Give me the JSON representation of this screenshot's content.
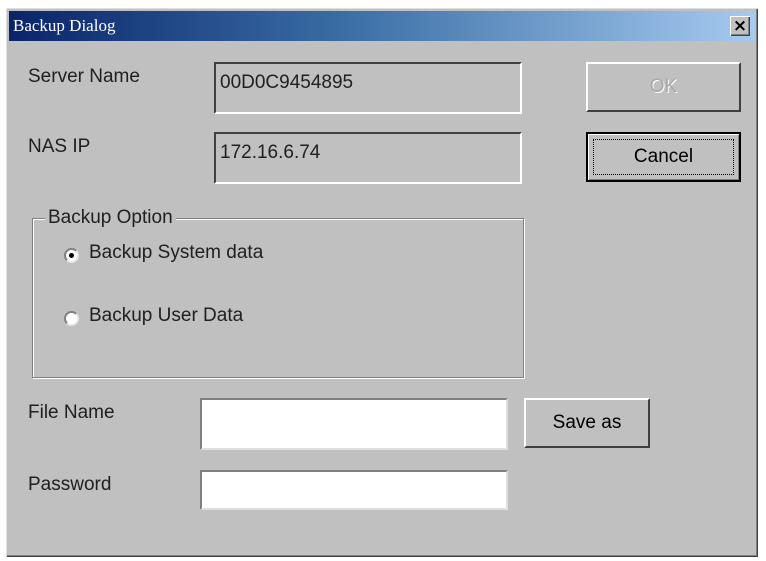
{
  "window": {
    "title": "Backup Dialog",
    "close_glyph": "×"
  },
  "fields": {
    "server_name_label": "Server Name",
    "server_name_value": "00D0C9454895",
    "nas_ip_label": "NAS IP",
    "nas_ip_value": "172.16.6.74",
    "file_name_label": "File Name",
    "file_name_value": "",
    "password_label": "Password",
    "password_value": ""
  },
  "buttons": {
    "ok": "OK",
    "ok_enabled": false,
    "cancel": "Cancel",
    "save_as": "Save as"
  },
  "backup_option": {
    "legend": "Backup Option",
    "options": [
      {
        "label": "Backup System data",
        "selected": true
      },
      {
        "label": "Backup User Data",
        "selected": false
      }
    ]
  },
  "icons": {
    "close": "close-icon",
    "radio_selected": "radio-selected-icon",
    "radio_unselected": "radio-unselected-icon"
  },
  "colors": {
    "dialog_bg": "#c0c0c0",
    "titlebar_start": "#0a246a",
    "titlebar_end": "#a6caf0",
    "disabled_text": "#a8a8a8"
  }
}
